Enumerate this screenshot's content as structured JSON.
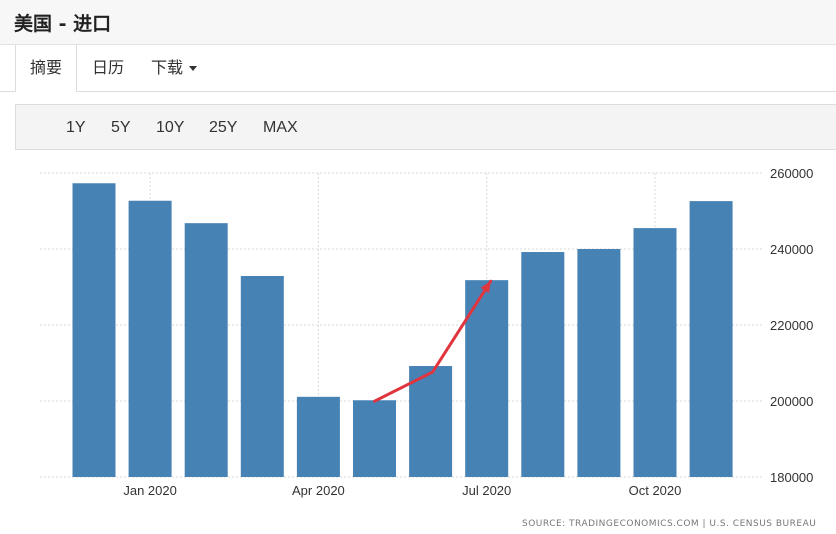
{
  "window": {
    "title": "美国 - 进口"
  },
  "tabs": [
    {
      "label": "摘要",
      "active": true
    },
    {
      "label": "日历"
    },
    {
      "label": "下载",
      "has_dropdown": true
    }
  ],
  "ranges": [
    "1Y",
    "5Y",
    "10Y",
    "25Y",
    "MAX"
  ],
  "source": "SOURCE: TRADINGECONOMICS.COM | U.S. CENSUS BUREAU",
  "colors": {
    "bar": "#4682b4",
    "trend_arrow": "#e0353f",
    "grid": "#d9d9d9"
  },
  "chart_data": {
    "type": "bar",
    "categories": [
      "Dec 2019",
      "Jan 2020",
      "Feb 2020",
      "Mar 2020",
      "Apr 2020",
      "May 2020",
      "Jun 2020",
      "Jul 2020",
      "Aug 2020",
      "Sep 2020",
      "Oct 2020",
      "Nov 2020"
    ],
    "values": [
      257300,
      252700,
      246800,
      232900,
      201100,
      200200,
      209200,
      231800,
      239200,
      240000,
      245500,
      252600
    ],
    "x_tick_labels": [
      "Jan 2020",
      "Apr 2020",
      "Jul 2020",
      "Oct 2020"
    ],
    "y_tick_labels": [
      "260000",
      "240000",
      "220000",
      "200000",
      "180000"
    ],
    "y_ticks": [
      260000,
      240000,
      220000,
      200000,
      180000
    ],
    "ylim": [
      180000,
      260000
    ],
    "y_axis_position": "right",
    "grid": true,
    "annotation": "red arrow from May 2020 through Jun 2020 to Jul 2020"
  }
}
